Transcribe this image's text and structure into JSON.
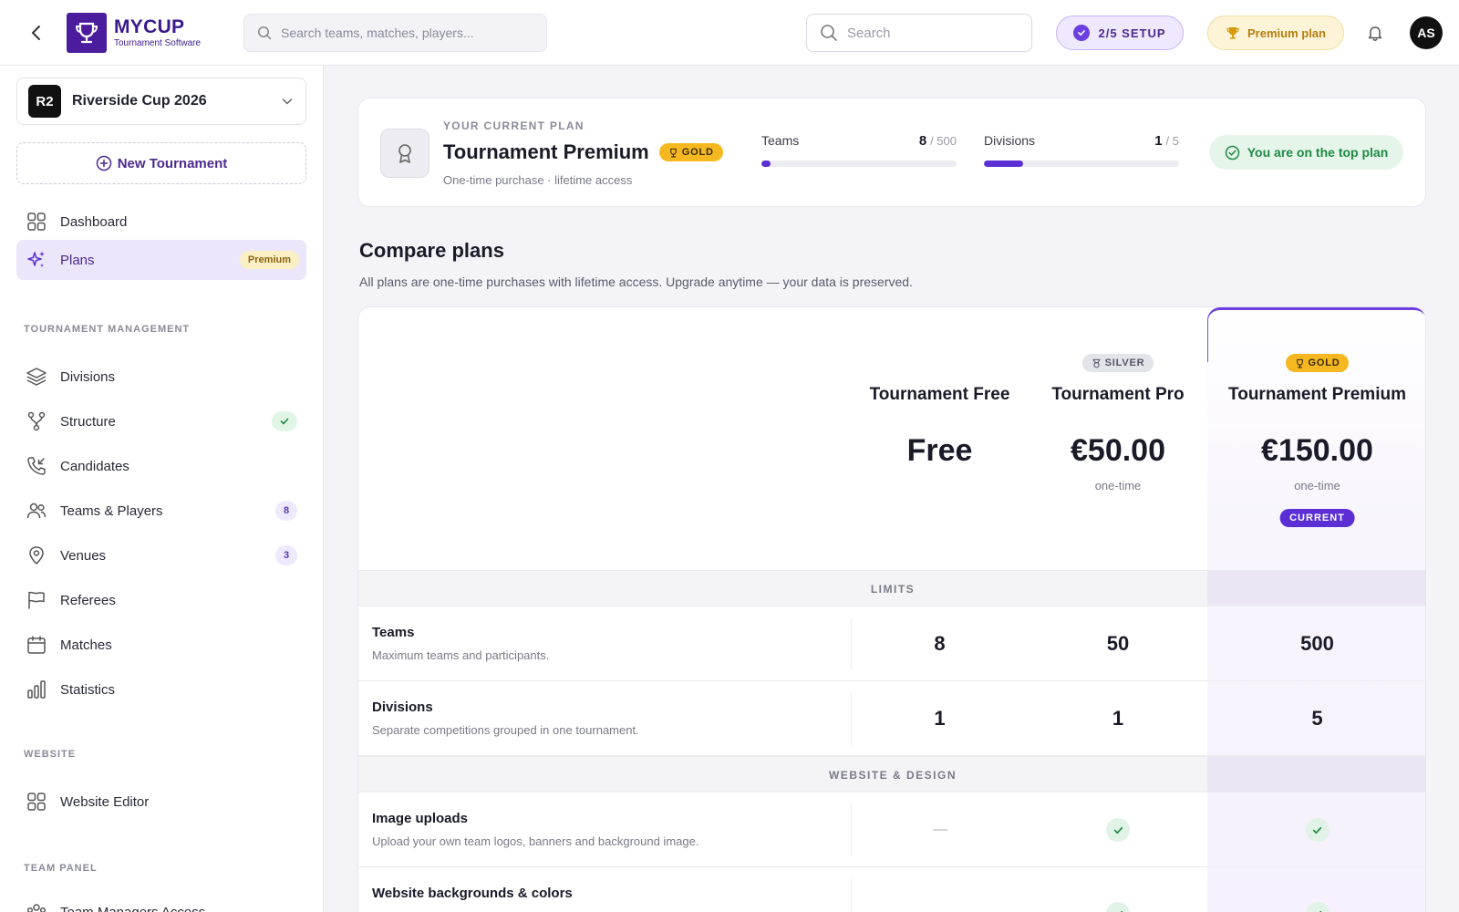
{
  "header": {
    "logo_name": "MYCUP",
    "logo_sub": "Tournament Software",
    "search_placeholder": "Search teams, matches, players...",
    "search_small_placeholder": "Search",
    "setup_label": "2/5 SETUP",
    "premium_label": "Premium plan",
    "avatar_initials": "AS"
  },
  "sidebar": {
    "tournament_badge": "R2",
    "tournament_name": "Riverside Cup 2026",
    "new_tournament": "New Tournament",
    "top_items": [
      {
        "label": "Dashboard",
        "icon": "grid-icon"
      },
      {
        "label": "Plans",
        "icon": "sparkles-icon",
        "badge": "Premium"
      }
    ],
    "sections": [
      {
        "title": "TOURNAMENT MANAGEMENT"
      },
      {
        "title": "WEBSITE"
      },
      {
        "title": "TEAM PANEL"
      }
    ],
    "mgmt_items": [
      {
        "label": "Divisions",
        "icon": "layers-icon"
      },
      {
        "label": "Structure",
        "icon": "branch-icon"
      },
      {
        "label": "Candidates",
        "icon": "phone-incoming-icon"
      },
      {
        "label": "Teams & Players",
        "icon": "users-icon",
        "count": "8"
      },
      {
        "label": "Venues",
        "icon": "map-pin-icon",
        "count": "3"
      },
      {
        "label": "Referees",
        "icon": "flag-icon"
      },
      {
        "label": "Matches",
        "icon": "calendar-icon"
      },
      {
        "label": "Statistics",
        "icon": "bar-chart-icon"
      }
    ],
    "website_items": [
      {
        "label": "Website Editor",
        "icon": "grid-icon"
      }
    ],
    "team_panel_items": [
      {
        "label": "Team Managers Access",
        "icon": "users-group-icon"
      }
    ]
  },
  "current_plan": {
    "kicker": "YOUR CURRENT PLAN",
    "title": "Tournament Premium",
    "tag": "GOLD",
    "subtitle": "One-time purchase · lifetime access",
    "teams_label": "Teams",
    "teams_used": "8",
    "teams_limit": "/ 500",
    "teams_fraction": 0.016,
    "divisions_label": "Divisions",
    "divisions_used": "1",
    "divisions_limit": "/ 5",
    "divisions_fraction": 0.2,
    "top_plan_label": "You are on the top plan"
  },
  "compare": {
    "title": "Compare plans",
    "subtitle": "All plans are one-time purchases with lifetime access. Upgrade anytime — your data is preserved.",
    "plans": [
      {
        "name": "Tournament Free",
        "price": "Free",
        "note": "",
        "tag": ""
      },
      {
        "name": "Tournament Pro",
        "price": "€50.00",
        "note": "one-time",
        "tag": "SILVER"
      },
      {
        "name": "Tournament Premium",
        "price": "€150.00",
        "note": "one-time",
        "tag": "GOLD",
        "current": "CURRENT"
      }
    ],
    "sections": [
      {
        "label": "LIMITS",
        "rows": [
          {
            "name": "Teams",
            "desc": "Maximum teams and participants.",
            "values": [
              "8",
              "50",
              "500"
            ]
          },
          {
            "name": "Divisions",
            "desc": "Separate competitions grouped in one tournament.",
            "values": [
              "1",
              "1",
              "5"
            ]
          }
        ]
      },
      {
        "label": "WEBSITE & DESIGN",
        "rows": [
          {
            "name": "Image uploads",
            "desc": "Upload your own team logos, banners and background image.",
            "values": [
              "dash",
              "check",
              "check"
            ]
          },
          {
            "name": "Website backgrounds & colors",
            "desc": "",
            "values": [
              "dash",
              "check",
              "check"
            ]
          }
        ]
      }
    ]
  },
  "colors": {
    "brand": "#4b1d9e",
    "accent": "#5b2fd4",
    "gold": "#f5b820",
    "success": "#1e8a45"
  }
}
